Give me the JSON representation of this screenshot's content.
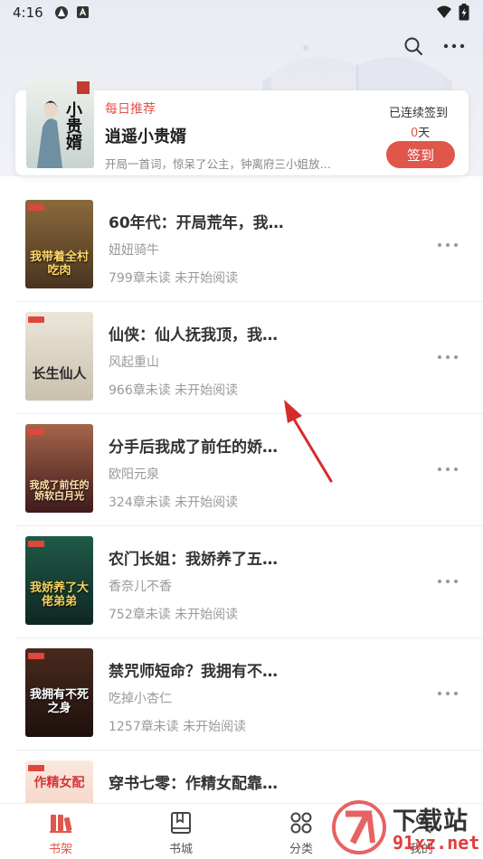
{
  "status_bar": {
    "time": "4:16"
  },
  "daily": {
    "tag": "每日推荐",
    "title": "逍遥小贵婿",
    "description": "开局一首词，惊呆了公主，钟离府三小姐放…",
    "cover_text": "小贵婿",
    "streak_label": "已连续签到",
    "streak_count": "0",
    "streak_unit": "天",
    "checkin_label": "签到"
  },
  "books": [
    {
      "title": "60年代：开局荒年，我…",
      "author": "妞妞骑牛",
      "progress": "799章未读 未开始阅读",
      "cover_text": "我带着全村吃肉",
      "cover_bg": "#5a4226"
    },
    {
      "title": "仙侠：仙人抚我顶，我…",
      "author": "风起重山",
      "progress": "966章未读 未开始阅读",
      "cover_text": "长生仙人",
      "cover_bg": "#d9d2c4"
    },
    {
      "title": "分手后我成了前任的娇…",
      "author": "欧阳元泉",
      "progress": "324章未读 未开始阅读",
      "cover_text": "我成了前任的娇软白月光",
      "cover_bg": "#6b2a2a"
    },
    {
      "title": "农门长姐：我娇养了五…",
      "author": "香奈儿不香",
      "progress": "752章未读 未开始阅读",
      "cover_text": "我娇养了大佬弟弟",
      "cover_bg": "#123a33"
    },
    {
      "title": "禁咒师短命？我拥有不…",
      "author": "吃掉小杏仁",
      "progress": "1257章未读 未开始阅读",
      "cover_text": "我拥有不死之身",
      "cover_bg": "#2c1a14"
    },
    {
      "title": "穿书七零：作精女配靠…",
      "author": "",
      "progress": "",
      "cover_text": "作精女配",
      "cover_bg": "#f5ddd0"
    }
  ],
  "tabs": [
    {
      "label": "书架",
      "icon": "bookshelf-icon",
      "active": true
    },
    {
      "label": "书城",
      "icon": "bookstore-icon",
      "active": false
    },
    {
      "label": "分类",
      "icon": "category-icon",
      "active": false
    },
    {
      "label": "我的",
      "icon": "profile-icon",
      "active": false
    }
  ],
  "watermark": {
    "text": "下载站",
    "url": "91xz.net"
  },
  "colors": {
    "accent": "#e0564b",
    "background_top": "#e9ebf3",
    "annotation_arrow": "#d52b2b"
  }
}
